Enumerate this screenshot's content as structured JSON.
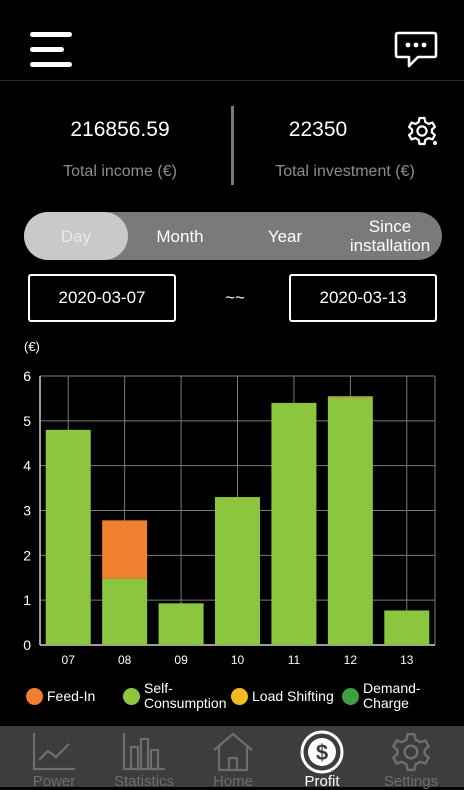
{
  "header": {
    "menu_icon": "hamburger-menu-icon",
    "chat_icon": "chat-bubble-icon"
  },
  "stats": {
    "total_income_value": "216856.59",
    "total_income_label": "Total income (€)",
    "total_investment_value": "22350",
    "total_investment_label": "Total investment (€)",
    "settings_icon": "gear-icon"
  },
  "period_tabs": [
    {
      "label": "Day",
      "active": true
    },
    {
      "label": "Month",
      "active": false
    },
    {
      "label": "Year",
      "active": false
    },
    {
      "label": "Since installation",
      "active": false
    }
  ],
  "date_range": {
    "start": "2020-03-07",
    "separator": "~~",
    "end": "2020-03-13"
  },
  "chart_data": {
    "type": "bar",
    "stacked": true,
    "unit_label": "(€)",
    "categories": [
      "07",
      "08",
      "09",
      "10",
      "11",
      "12",
      "13"
    ],
    "ylim": [
      0,
      6
    ],
    "yticks": [
      0,
      1,
      2,
      3,
      4,
      5,
      6
    ],
    "grid": true,
    "series": [
      {
        "name": "Feed-In",
        "color": "#f08030",
        "values": [
          0,
          1.3,
          0,
          0,
          0,
          0.02,
          0
        ]
      },
      {
        "name": "Self-Consumption",
        "color": "#8cc63f",
        "values": [
          4.8,
          1.48,
          0.93,
          3.3,
          5.4,
          5.53,
          0.77
        ]
      },
      {
        "name": "Load Shifting",
        "color": "#f5b922",
        "values": [
          0,
          0,
          0,
          0,
          0,
          0,
          0
        ]
      },
      {
        "name": "Demand-Charge",
        "color": "#3aa043",
        "values": [
          0,
          0,
          0,
          0,
          0,
          0,
          0
        ]
      }
    ],
    "legend_position": "bottom"
  },
  "legend": [
    {
      "label": "Feed-In",
      "color": "#f08030"
    },
    {
      "label": "Self-\nConsumption",
      "color": "#8cc63f"
    },
    {
      "label": "Load Shifting",
      "color": "#f5b922"
    },
    {
      "label": "Demand-\nCharge",
      "color": "#3aa043"
    }
  ],
  "tabbar": [
    {
      "label": "Power",
      "icon": "line-chart-icon",
      "active": false
    },
    {
      "label": "Statistics",
      "icon": "bar-chart-icon",
      "active": false
    },
    {
      "label": "Home",
      "icon": "home-icon",
      "active": false
    },
    {
      "label": "Profit",
      "icon": "dollar-coin-icon",
      "active": true
    },
    {
      "label": "Settings",
      "icon": "gear-icon",
      "active": false
    }
  ]
}
